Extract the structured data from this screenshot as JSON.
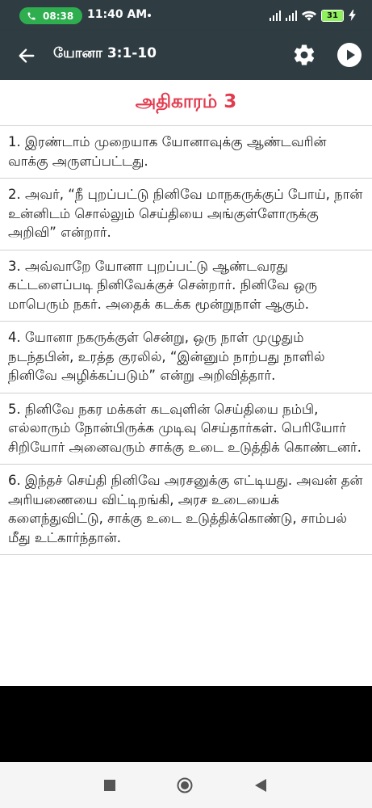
{
  "status_bar": {
    "call_time": "08:38",
    "time": "11:40 AM",
    "battery_level": "31"
  },
  "app_bar": {
    "title": "யோனா 3:1-10"
  },
  "chapter": {
    "heading": "அதிகாரம் 3"
  },
  "verses": [
    {
      "text": "1. இரண்டாம் முறையாக யோனாவுக்கு ஆண்டவரின் வாக்கு அருளப்பட்டது."
    },
    {
      "text": "2. அவர், “நீ புறப்பட்டு நினிவே மாநகருக்குப் போய், நான் உன்னிடம் சொல்லும் செய்தியை அங்குள்ளோருக்கு அறிவி” என்றார்."
    },
    {
      "text": "3. அவ்வாறே யோனா புறப்பட்டு ஆண்டவரது கட்டளைப்படி நினிவேக்குச் சென்றார். நினிவே ஒரு மாபெரும் நகர். அதைக் கடக்க மூன்றுநாள் ஆகும்."
    },
    {
      "text": "4. யோனா நகருக்குள் சென்று, ஒரு நாள் முழுதும் நடந்தபின், உரத்த குரலில், “இன்னும் நாற்பது நாளில் நினிவே அழிக்கப்படும்” என்று அறிவித்தார்."
    },
    {
      "text": "5. நினிவே நகர மக்கள் கடவுளின் செய்தியை நம்பி, எல்லாரும் நோன்பிருக்க முடிவு செய்தார்கள். பெரியோர் சிறியோர் அனைவரும் சாக்கு உடை உடுத்திக் கொண்டனர்."
    },
    {
      "text": "6. இந்தச் செய்தி நினிவே அரசனுக்கு எட்டியது. அவன் தன் அரியணையை விட்டிறங்கி, அரச உடையைக் களைந்துவிட்டு, சாக்கு உடை உடுத்திக்கொண்டு, சாம்பல் மீது உட்கார்ந்தான்."
    }
  ],
  "colors": {
    "app_bar": "#2f3d43",
    "heading": "#e23a4e",
    "call_pill": "#2eae4e",
    "battery": "#8ef05a"
  },
  "icons": {
    "back": "arrow-left-icon",
    "settings": "gear-icon",
    "play": "play-icon",
    "nav_recents": "square-icon",
    "nav_home": "circle-icon",
    "nav_back": "triangle-left-icon"
  }
}
